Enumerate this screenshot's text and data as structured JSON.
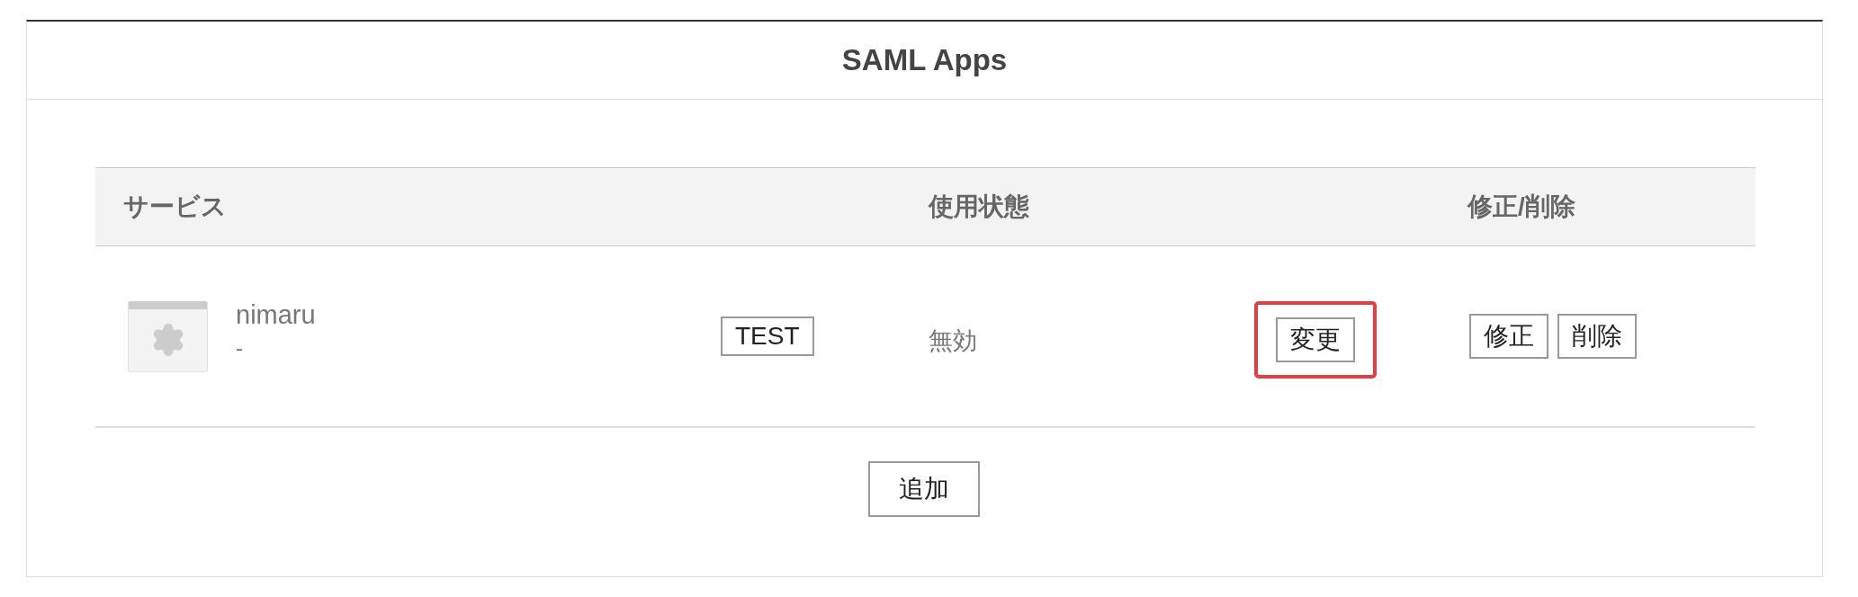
{
  "panel": {
    "title": "SAML Apps"
  },
  "table": {
    "columns": [
      "サービス",
      "使用状態",
      "修正/削除"
    ],
    "rows": [
      {
        "name": "nimaru",
        "subtitle": "-",
        "test_button": "TEST",
        "status": "無効",
        "change_button": {
          "label": "変更",
          "highlighted": true
        },
        "actions": [
          "修正",
          "削除"
        ]
      }
    ]
  },
  "add_button": "追加"
}
